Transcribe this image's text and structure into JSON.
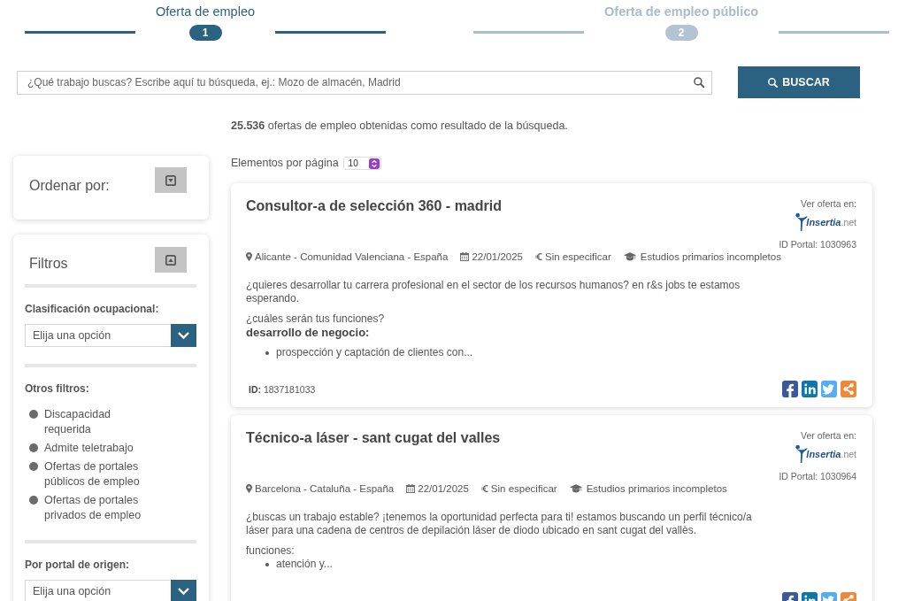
{
  "steps": [
    {
      "label": "Oferta de empleo",
      "number": "1",
      "selected": true
    },
    {
      "label": "Oferta de empleo público",
      "number": "2",
      "selected": false
    }
  ],
  "search": {
    "placeholder": "¿Qué trabajo buscas? Escribe aquí tu búsqueda, ej.: Mozo de almacén, Madrid",
    "button": "BUSCAR"
  },
  "results_summary": "**25.536** ofertas de empleo obtenidas como resultado de la búsqueda.",
  "per_page": {
    "label": "Elementos por página",
    "value": "10"
  },
  "sort_panel": {
    "title": "Ordenar por:",
    "expanded": false
  },
  "filters_panel": {
    "title": "Filtros",
    "expanded": true,
    "sections": [
      {
        "kind": "select",
        "label": "Clasificación ocupacional:",
        "value": "Elija una opción"
      },
      {
        "kind": "options",
        "label": "Otros filtros:",
        "options": [
          {
            "label": "Discapacidad requerida",
            "selected": false
          },
          {
            "label": "Admite teletrabajo",
            "selected": false
          },
          {
            "label": "Ofertas de portales públicos de empleo",
            "selected": false
          },
          {
            "label": "Ofertas de portales privados de empleo",
            "selected": false
          }
        ]
      },
      {
        "kind": "select",
        "label": "Por portal de origen:",
        "value": "Elija una opción"
      }
    ]
  },
  "offers": [
    {
      "title": "Consultor-a de selección 360 - madrid",
      "source_label": "Ver oferta en:",
      "portal_logo": {
        "brand": "Insertia",
        "suffix": ".net"
      },
      "portal_id": "ID Portal: 1030963",
      "meta": [
        {
          "kind": "location",
          "text": "Alicante - Comunidad Valenciana - España"
        },
        {
          "kind": "date",
          "text": "22/01/2025"
        },
        {
          "kind": "salary",
          "text": "Sin especificar"
        },
        {
          "kind": "education",
          "text": "Estudios primarios incompletos"
        }
      ],
      "description": [
        {
          "kind": "paragraph",
          "text": "¿quieres desarrollar tu carrera profesional en el sector de los recursos humanos? en r&s jobs te estamos esperando."
        },
        {
          "kind": "line",
          "text": "¿cuáles serán tus funciones?"
        },
        {
          "kind": "heading",
          "text": "desarrollo de negocio:"
        },
        {
          "kind": "bullet",
          "text": "prospección y captación de clientes con..."
        }
      ],
      "id": "**ID:** 1837181033"
    },
    {
      "title": "Técnico-a láser - sant cugat del valles",
      "source_label": "Ver oferta en:",
      "portal_logo": {
        "brand": "Insertia",
        "suffix": ".net"
      },
      "portal_id": "ID Portal: 1030964",
      "meta": [
        {
          "kind": "location",
          "text": "Barcelona - Cataluña - España"
        },
        {
          "kind": "date",
          "text": "22/01/2025"
        },
        {
          "kind": "salary",
          "text": "Sin especificar"
        },
        {
          "kind": "education",
          "text": "Estudios primarios incompletos"
        }
      ],
      "description": [
        {
          "kind": "paragraph",
          "text": "¿buscas un trabajo estable? ¡tenemos la oportunidad perfecta para ti! estamos buscando un perfil técnico/a láser para una cadena de centros de depilación láser de diodo ubicado en sant cugat del vallès."
        },
        {
          "kind": "line",
          "text": "funciones:"
        },
        {
          "kind": "bullet",
          "text": "atención y..."
        }
      ]
    }
  ]
}
